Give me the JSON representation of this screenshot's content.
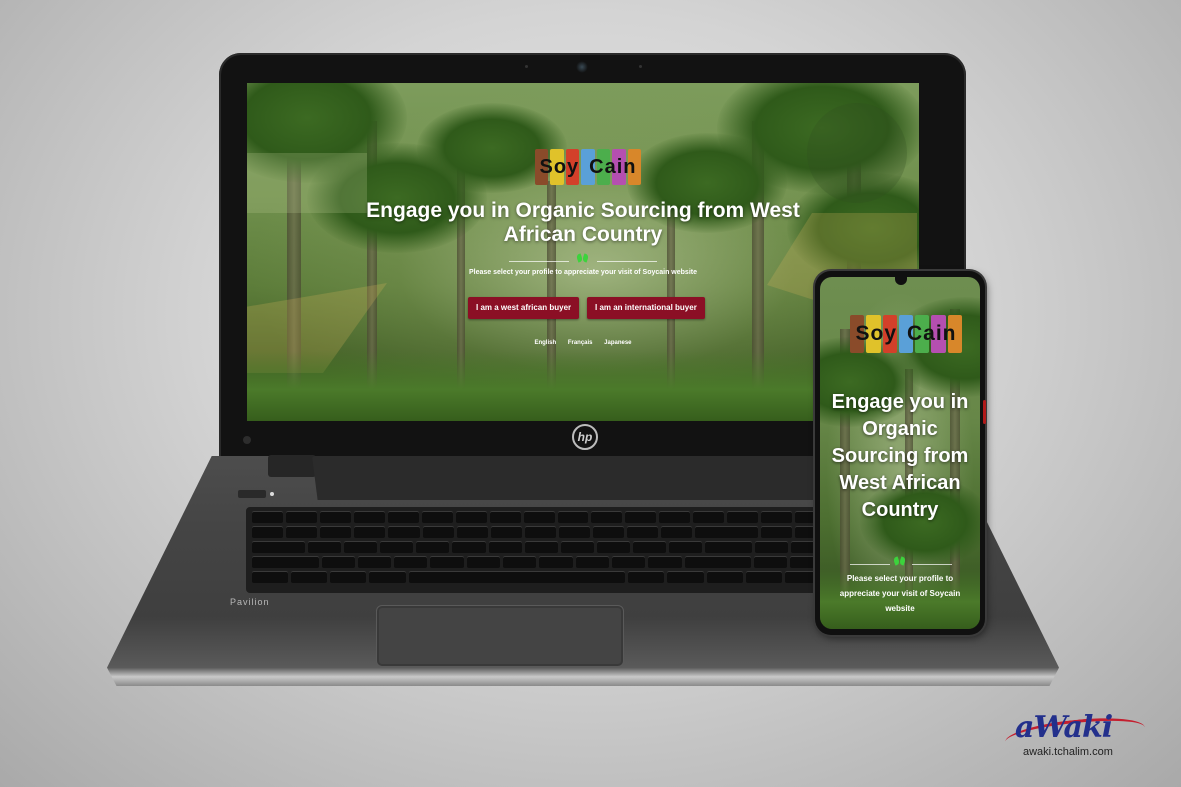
{
  "brand": {
    "logo_word1": "Soy",
    "logo_word2": "Cain",
    "logo_tile_colors": [
      "#8a4b2a",
      "#e0c22a",
      "#d3402a",
      "#5aa0d8",
      "#4cae4c",
      "#b54fb0",
      "#d8872a"
    ]
  },
  "laptop": {
    "brand_mark": "hp",
    "model_label": "Pavilion",
    "page": {
      "headline": "Engage you in Organic Sourcing from West African Country",
      "subtitle": "Please select your profile to appreciate your visit of Soycain website",
      "buttons": {
        "west_african_buyer": "I am a west african buyer",
        "international_buyer": "I am an international buyer"
      },
      "languages": [
        "English",
        "Français",
        "Japanese"
      ]
    }
  },
  "phone": {
    "page": {
      "headline": "Engage you in Organic Sourcing from West African Country",
      "subtitle": "Please select your profile to appreciate your visit of Soycain website"
    }
  },
  "watermark": {
    "logo_text": "aWaki",
    "url": "awaki.tchalim.com"
  },
  "colors": {
    "button_bg": "#8b0f25",
    "sprout": "#3cd33c",
    "watermark_blue": "#23308c",
    "watermark_red": "#c41f2f"
  }
}
